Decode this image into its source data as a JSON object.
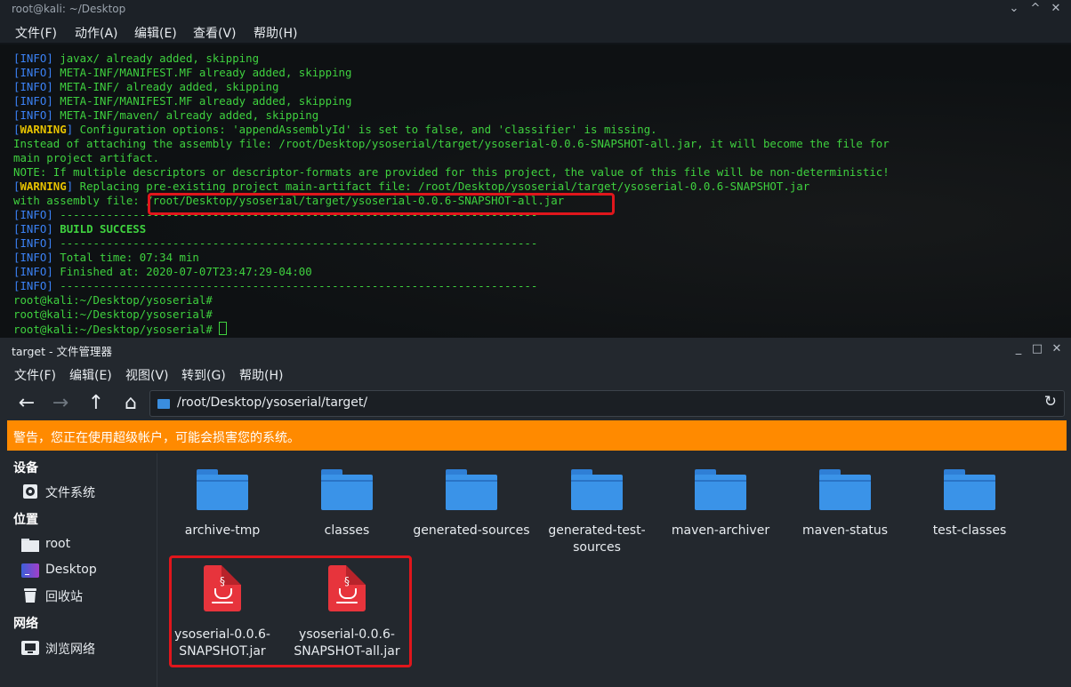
{
  "terminal": {
    "title": "root@kali: ~/Desktop",
    "menu": [
      "文件(F)",
      "动作(A)",
      "编辑(E)",
      "查看(V)",
      "帮助(H)"
    ],
    "window_controls": [
      "minimize-icon",
      "maximize-icon",
      "close-icon"
    ],
    "lines": [
      {
        "tag": "INFO",
        "text": " javax/ already added, skipping"
      },
      {
        "tag": "INFO",
        "text": " META-INF/MANIFEST.MF already added, skipping"
      },
      {
        "tag": "INFO",
        "text": " META-INF/ already added, skipping"
      },
      {
        "tag": "INFO",
        "text": " META-INF/MANIFEST.MF already added, skipping"
      },
      {
        "tag": "INFO",
        "text": " META-INF/maven/ already added, skipping"
      },
      {
        "tag": "WARNING",
        "text": " Configuration options: 'appendAssemblyId' is set to false, and 'classifier' is missing."
      },
      {
        "tag": "",
        "text": "Instead of attaching the assembly file: /root/Desktop/ysoserial/target/ysoserial-0.0.6-SNAPSHOT-all.jar, it will become the file for"
      },
      {
        "tag": "",
        "text": "main project artifact."
      },
      {
        "tag": "",
        "text": "NOTE: If multiple descriptors or descriptor-formats are provided for this project, the value of this file will be non-deterministic!"
      },
      {
        "tag": "WARNING",
        "text": " Replacing pre-existing project main-artifact file: /root/Desktop/ysoserial/target/ysoserial-0.0.6-SNAPSHOT.jar"
      },
      {
        "tag": "",
        "text": "with assembly file: /root/Desktop/ysoserial/target/ysoserial-0.0.6-SNAPSHOT-all.jar"
      },
      {
        "tag": "INFO",
        "text": " ------------------------------------------------------------------------"
      },
      {
        "tag": "INFO",
        "text": " BUILD SUCCESS"
      },
      {
        "tag": "INFO",
        "text": " ------------------------------------------------------------------------"
      },
      {
        "tag": "INFO",
        "text": " Total time: 07:34 min"
      },
      {
        "tag": "INFO",
        "text": " Finished at: 2020-07-07T23:47:29-04:00"
      },
      {
        "tag": "INFO",
        "text": " ------------------------------------------------------------------------"
      },
      {
        "tag": "",
        "text": "root@kali:~/Desktop/ysoserial#"
      },
      {
        "tag": "",
        "text": "root@kali:~/Desktop/ysoserial#"
      },
      {
        "tag": "",
        "text": "root@kali:~/Desktop/ysoserial# "
      }
    ],
    "colors": {
      "text": "#3fd13f",
      "info_tag": "#3b82f6",
      "warning_tag": "#e6c200"
    }
  },
  "file_manager": {
    "title": "target - 文件管理器",
    "menu": [
      "文件(F)",
      "编辑(E)",
      "视图(V)",
      "转到(G)",
      "帮助(H)"
    ],
    "path": "/root/Desktop/ysoserial/target/",
    "warning": "警告，您正在使用超级帐户，可能会损害您的系统。",
    "sidebar": {
      "devices_header": "设备",
      "devices": [
        {
          "label": "文件系统",
          "icon": "drive-icon"
        }
      ],
      "places_header": "位置",
      "places": [
        {
          "label": "root",
          "icon": "home-folder-icon"
        },
        {
          "label": "Desktop",
          "icon": "desktop-icon"
        },
        {
          "label": "回收站",
          "icon": "trash-icon"
        }
      ],
      "network_header": "网络",
      "network": [
        {
          "label": "浏览网络",
          "icon": "network-icon"
        }
      ]
    },
    "folders": [
      "archive-tmp",
      "classes",
      "generated-sources",
      "generated-test-sources",
      "maven-archiver",
      "maven-status",
      "test-classes"
    ],
    "files": [
      "ysoserial-0.0.6-SNAPSHOT.jar",
      "ysoserial-0.0.6-SNAPSHOT-all.jar"
    ],
    "colors": {
      "warning_bar": "#ff8a00",
      "folder": "#3a93e8",
      "jar": "#e7343c",
      "highlight_box": "#e0161c"
    }
  }
}
